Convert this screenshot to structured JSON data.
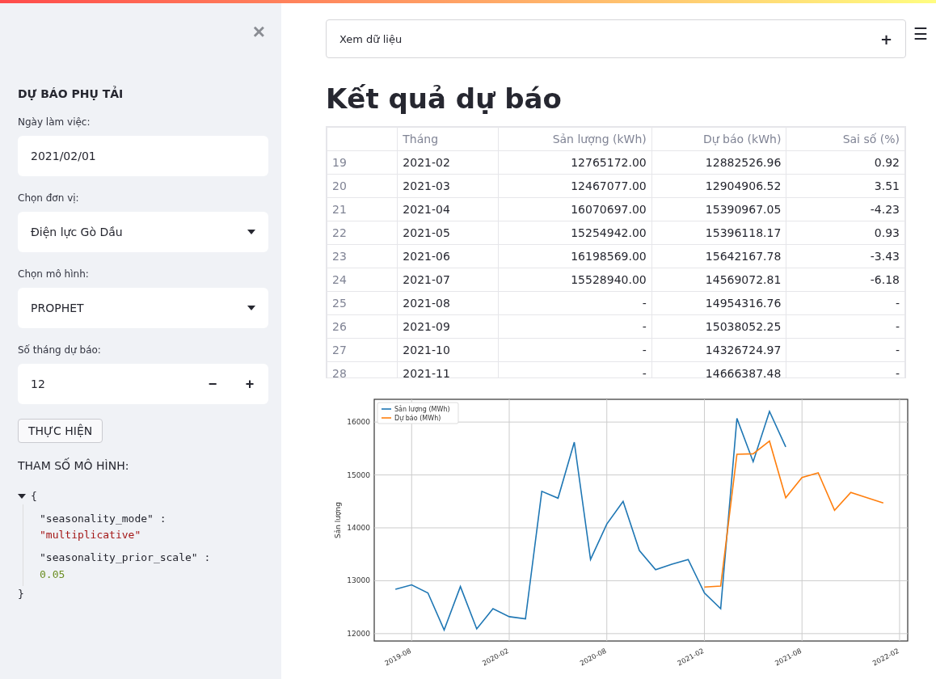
{
  "sidebar": {
    "close": "×",
    "heading": "DỰ BÁO PHỤ TẢI",
    "fields": [
      {
        "kind": "text",
        "label": "Ngày làm việc:",
        "value": "2021/02/01"
      },
      {
        "kind": "select",
        "label": "Chọn đơn vị:",
        "value": "Điện lực Gò Dầu"
      },
      {
        "kind": "select",
        "label": "Chọn mô hình:",
        "value": "PROPHET"
      },
      {
        "kind": "number",
        "label": "Số tháng dự báo:",
        "value": "12",
        "minus": "−",
        "plus": "+"
      }
    ],
    "button": "THỰC HIỆN",
    "params_label": "THAM SỐ MÔ HÌNH:",
    "json_view": {
      "expanded": true,
      "open": "{",
      "close": "}",
      "entries": [
        {
          "key": "\"seasonality_mode\"",
          "colon": ":",
          "value": "\"multiplicative\"",
          "kind": "string"
        },
        {
          "key": "\"seasonality_prior_scale\"",
          "colon": ":",
          "value": "0.05",
          "kind": "number"
        }
      ]
    }
  },
  "main": {
    "expander": {
      "label": "Xem dữ liệu",
      "toggle": "+",
      "expanded": false
    },
    "menu": "☰",
    "title": "Kết quả dự báo",
    "table": {
      "columns": [
        "",
        "Tháng",
        "Sản lượng (kWh)",
        "Dự báo (kWh)",
        "Sai số (%)"
      ],
      "rows": [
        [
          "19",
          "2021-02",
          "12765172.00",
          "12882526.96",
          "0.92"
        ],
        [
          "20",
          "2021-03",
          "12467077.00",
          "12904906.52",
          "3.51"
        ],
        [
          "21",
          "2021-04",
          "16070697.00",
          "15390967.05",
          "-4.23"
        ],
        [
          "22",
          "2021-05",
          "15254942.00",
          "15396118.17",
          "0.93"
        ],
        [
          "23",
          "2021-06",
          "16198569.00",
          "15642167.78",
          "-3.43"
        ],
        [
          "24",
          "2021-07",
          "15528940.00",
          "14569072.81",
          "-6.18"
        ],
        [
          "25",
          "2021-08",
          "-",
          "14954316.76",
          "-"
        ],
        [
          "26",
          "2021-09",
          "-",
          "15038052.25",
          "-"
        ],
        [
          "27",
          "2021-10",
          "-",
          "14326724.97",
          "-"
        ],
        [
          "28",
          "2021-11",
          "-",
          "14666387.48",
          "-"
        ]
      ]
    },
    "chart": {
      "chart_data": {
        "type": "line",
        "ylabel": "Sản lượng",
        "categories": [
          null,
          "2019-08",
          null,
          null,
          null,
          null,
          null,
          "2020-02",
          null,
          null,
          null,
          null,
          null,
          "2020-08",
          null,
          null,
          null,
          null,
          null,
          "2021-02",
          null,
          null,
          null,
          null,
          null,
          "2021-08",
          null,
          null,
          null,
          null,
          null,
          "2022-02"
        ],
        "series": [
          {
            "name": "Sản lượng (MWh)",
            "color": "#1f77b4",
            "values": [
              12840,
              12920,
              12770,
              12070,
              12890,
              12090,
              12470,
              12320,
              12280,
              14690,
              14560,
              15620,
              13400,
              14070,
              14500,
              13570,
              13210,
              13310,
              13400,
              12770,
              12470,
              16070,
              15250,
              16200,
              15530,
              null,
              null,
              null,
              null,
              null,
              null,
              null
            ]
          },
          {
            "name": "Dự báo (MWh)",
            "color": "#ff7f0e",
            "values": [
              null,
              null,
              null,
              null,
              null,
              null,
              null,
              null,
              null,
              null,
              null,
              null,
              null,
              null,
              null,
              null,
              null,
              null,
              null,
              12880,
              12900,
              15390,
              15400,
              15640,
              14570,
              14950,
              15040,
              14330,
              14670,
              14570,
              14470,
              null
            ]
          }
        ],
        "ylim": [
          11860,
          16430
        ],
        "grid": true,
        "legend": "upper left",
        "yticks": [
          12000,
          13000,
          14000,
          15000,
          16000
        ]
      }
    }
  }
}
